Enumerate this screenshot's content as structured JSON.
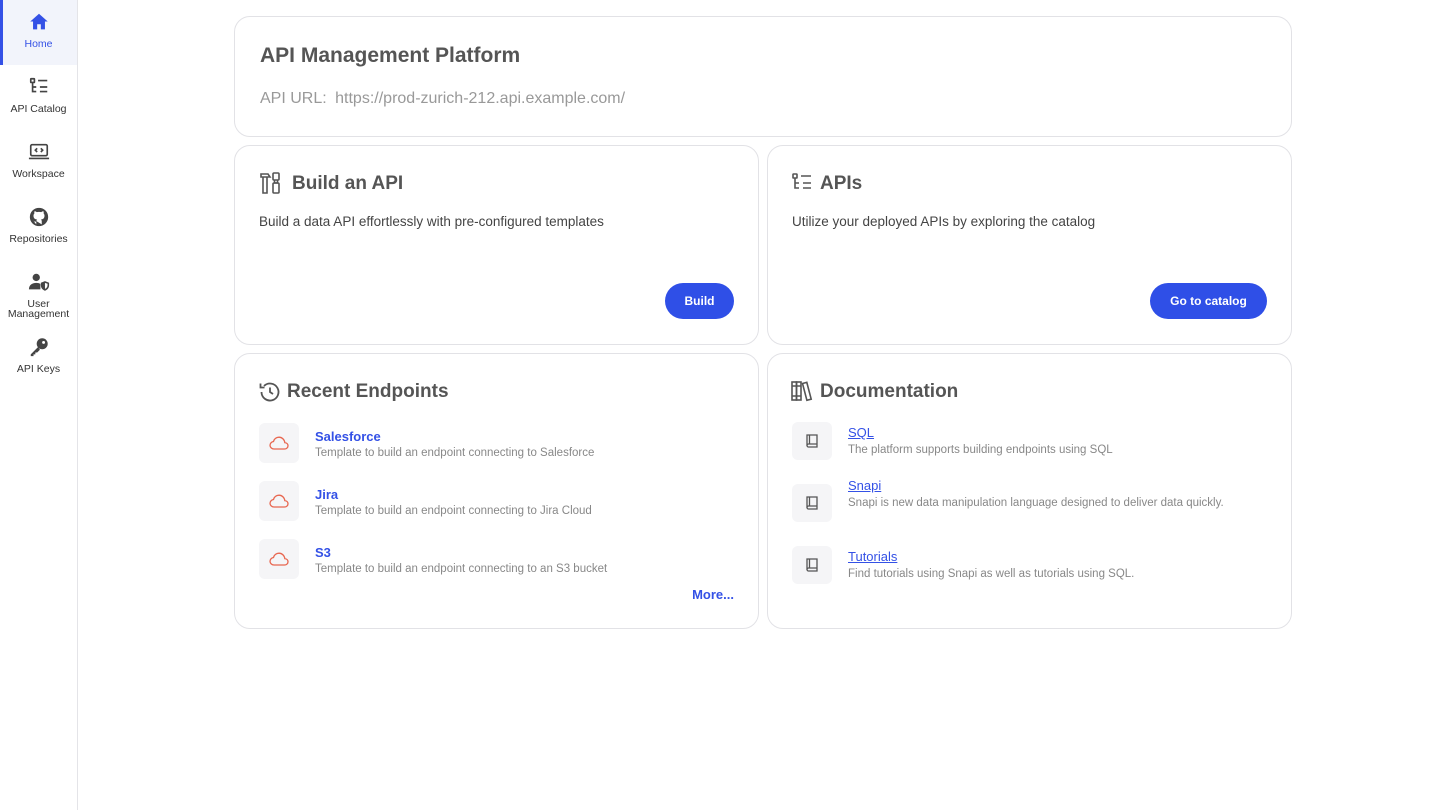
{
  "sidebar": {
    "items": [
      {
        "label": "Home",
        "icon": "home-icon",
        "active": true
      },
      {
        "label": "API Catalog",
        "icon": "list-tree-icon"
      },
      {
        "label": "Workspace",
        "icon": "laptop-code-icon"
      },
      {
        "label": "Repositories",
        "icon": "github-icon"
      },
      {
        "label": "User Management",
        "icon": "user-shield-icon"
      },
      {
        "label": "API Keys",
        "icon": "key-icon"
      }
    ]
  },
  "header_card": {
    "title": "API Management Platform",
    "url_label": "API URL:",
    "url_value": "https://prod-zurich-212.api.example.com/"
  },
  "build_card": {
    "title": "Build an API",
    "description": "Build a data API effortlessly with pre-configured templates",
    "button_label": "Build"
  },
  "apis_card": {
    "title": "APIs",
    "description": "Utilize your deployed APIs by exploring the catalog",
    "button_label": "Go to catalog"
  },
  "recent_card": {
    "title": "Recent Endpoints",
    "items": [
      {
        "name": "Salesforce",
        "description": "Template to build an endpoint connecting to Salesforce"
      },
      {
        "name": "Jira",
        "description": "Template to build an endpoint connecting to Jira Cloud"
      },
      {
        "name": "S3",
        "description": "Template to build an endpoint connecting to an S3 bucket"
      }
    ],
    "more_label": "More..."
  },
  "docs_card": {
    "title": "Documentation",
    "items": [
      {
        "name": "SQL",
        "description": "The platform supports building endpoints using SQL"
      },
      {
        "name": "Snapi",
        "description": "Snapi is new data manipulation language designed to deliver data quickly."
      },
      {
        "name": "Tutorials",
        "description": "Find tutorials using Snapi as well as tutorials using SQL."
      }
    ]
  },
  "colors": {
    "accent": "#2f4fe7",
    "cloud_icon": "#e8664f"
  }
}
